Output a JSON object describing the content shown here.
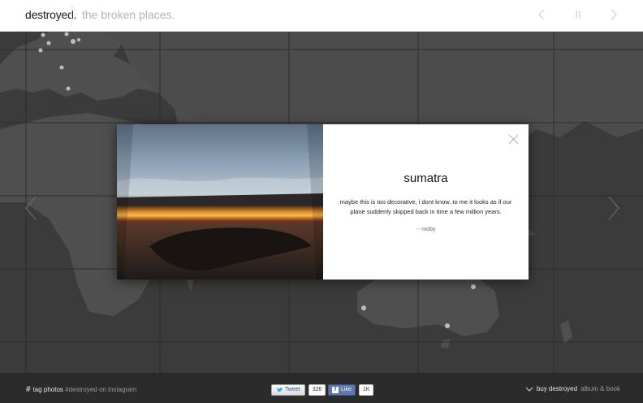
{
  "header": {
    "logo": "destroyed.",
    "tagline": "the broken places."
  },
  "modal": {
    "title": "sumatra",
    "description": "maybe this is too decorative, i dont know. to me it looks as if our plane suddenly skipped back in time a few million years.",
    "author": "-- moby"
  },
  "footer": {
    "tag_strong": "tag photos",
    "tag_rest": "#destroyed on instagram",
    "tweet_label": "Tweet",
    "tweet_count": "326",
    "like_label": "Like",
    "like_count": "1K",
    "buy_strong": "buy destroyed",
    "buy_rest": "album & book"
  },
  "colors": {
    "map_background": "#3a3a3a",
    "land": "#4d4d4d",
    "header": "#ffffff",
    "footer": "#2b2b2b"
  }
}
